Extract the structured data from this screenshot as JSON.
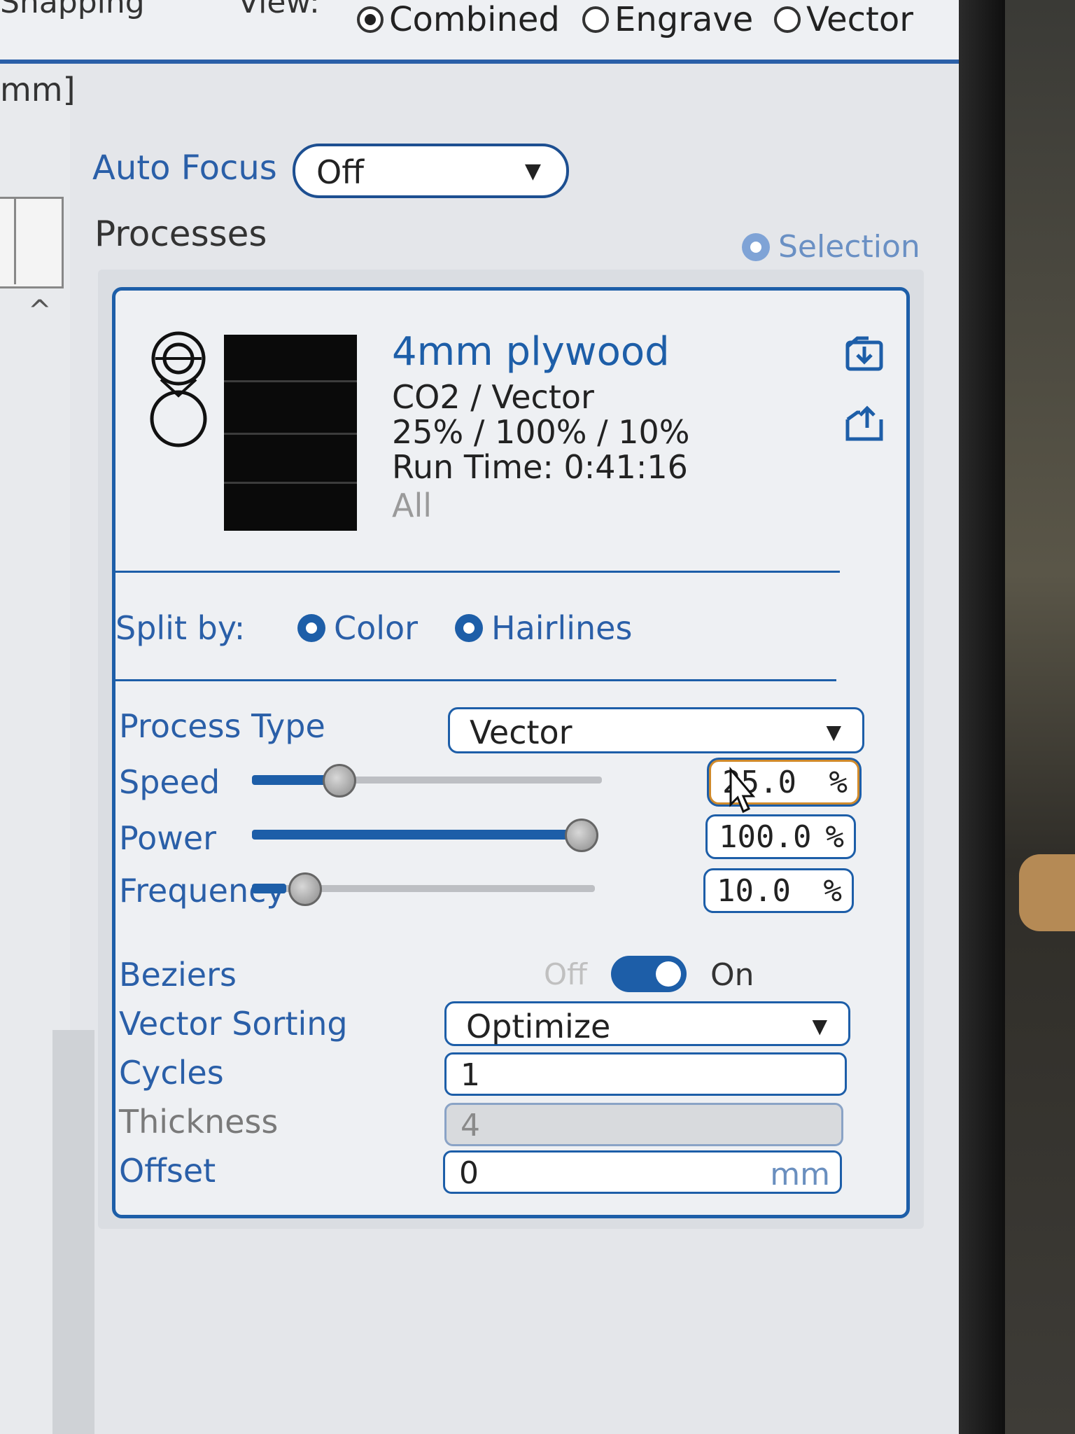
{
  "topbar": {
    "left_label": "Snapping",
    "view_label": "View:",
    "view_options": [
      "Combined",
      "Engrave",
      "Vector"
    ],
    "view_selected": "Combined"
  },
  "left": {
    "unit": "mm]"
  },
  "auto_focus": {
    "label": "Auto Focus",
    "value": "Off"
  },
  "processes": {
    "label": "Processes",
    "selection_label": "Selection"
  },
  "process_card": {
    "material": "4mm plywood",
    "laser": "CO2 / Vector",
    "settings_summary": "25% / 100% / 10%",
    "run_time": "Run Time: 0:41:16",
    "scope": "All"
  },
  "split_by": {
    "label": "Split by:",
    "options": [
      "Color",
      "Hairlines"
    ]
  },
  "params": {
    "process_type": {
      "label": "Process Type",
      "value": "Vector"
    },
    "speed": {
      "label": "Speed",
      "value": "25.0",
      "unit": "%",
      "level": 0.25
    },
    "power": {
      "label": "Power",
      "value": "100.0",
      "unit": "%",
      "level": 1.0
    },
    "frequency": {
      "label": "Frequency",
      "value": "10.0",
      "unit": "%",
      "level": 0.1
    },
    "beziers": {
      "label": "Beziers",
      "off_label": "Off",
      "on_label": "On",
      "state": "on"
    },
    "vector_sorting": {
      "label": "Vector Sorting",
      "value": "Optimize"
    },
    "cycles": {
      "label": "Cycles",
      "value": "1"
    },
    "thickness": {
      "label": "Thickness",
      "value": "4"
    },
    "offset": {
      "label": "Offset",
      "value": "0",
      "unit": "mm"
    }
  },
  "colors": {
    "accent": "#1d5ea8",
    "label_blue": "#2a5fa8",
    "focus_orange": "#d08a2b"
  },
  "icons": [
    "save-to-library-icon",
    "load-from-library-icon",
    "mouse-cursor-icon"
  ]
}
